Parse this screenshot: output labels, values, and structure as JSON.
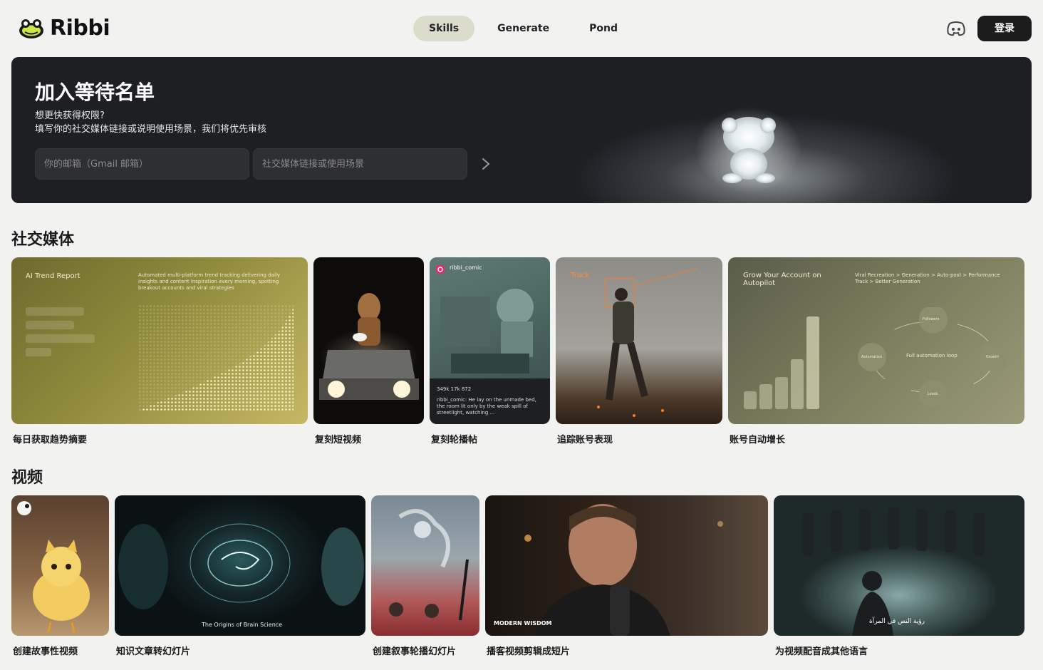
{
  "header": {
    "logo_text": "Ribbi",
    "nav": [
      "Skills",
      "Generate",
      "Pond"
    ],
    "login_label": "登录"
  },
  "waitlist": {
    "title": "加入等待名单",
    "subtitle_1": "想更快获得权限?",
    "subtitle_2": "填写你的社交媒体链接或说明使用场景，我们将优先审核",
    "email_placeholder": "你的邮箱（Gmail 邮箱）",
    "social_placeholder": "社交媒体链接或使用场景"
  },
  "social": {
    "title": "社交媒体",
    "cards": [
      {
        "label": "每日获取趋势摘要",
        "thumb_title": "AI Trend Report",
        "thumb_text": "Automated multi-platform trend tracking delivering daily insights and content inspiration every morning, spotting breakout accounts and viral strategies"
      },
      {
        "label": "复刻短视频"
      },
      {
        "label": "复刻轮播帖",
        "thumb_user": "ribbi_comic",
        "thumb_stats": "349k   17k   872",
        "thumb_caption": "ribbi_comic: He lay on the unmade bed, the room lit only by the weak spill of streetlight, watching ..."
      },
      {
        "label": "追踪账号表现",
        "thumb_title": "Track"
      },
      {
        "label": "账号自动增长",
        "thumb_title": "Grow Your Account on Autopilot",
        "thumb_text": "Viral Recreation > Generation > Auto-post > Performance Track > Better Generation",
        "cycle": [
          "Followers",
          "Growth",
          "Leads",
          "Automation"
        ],
        "cycle_center": "Full automation loop"
      }
    ]
  },
  "video": {
    "title": "视频",
    "cards": [
      {
        "label": "创建故事性视频"
      },
      {
        "label": "知识文章转幻灯片",
        "thumb_caption": "The Origins of Brain Science"
      },
      {
        "label": "创建叙事轮播幻灯片"
      },
      {
        "label": "播客视频剪辑成短片",
        "thumb_caption": "MODERN WISDOM"
      },
      {
        "label": "为视频配音成其他语言",
        "thumb_caption": "رؤية النص في المرآة"
      }
    ]
  }
}
